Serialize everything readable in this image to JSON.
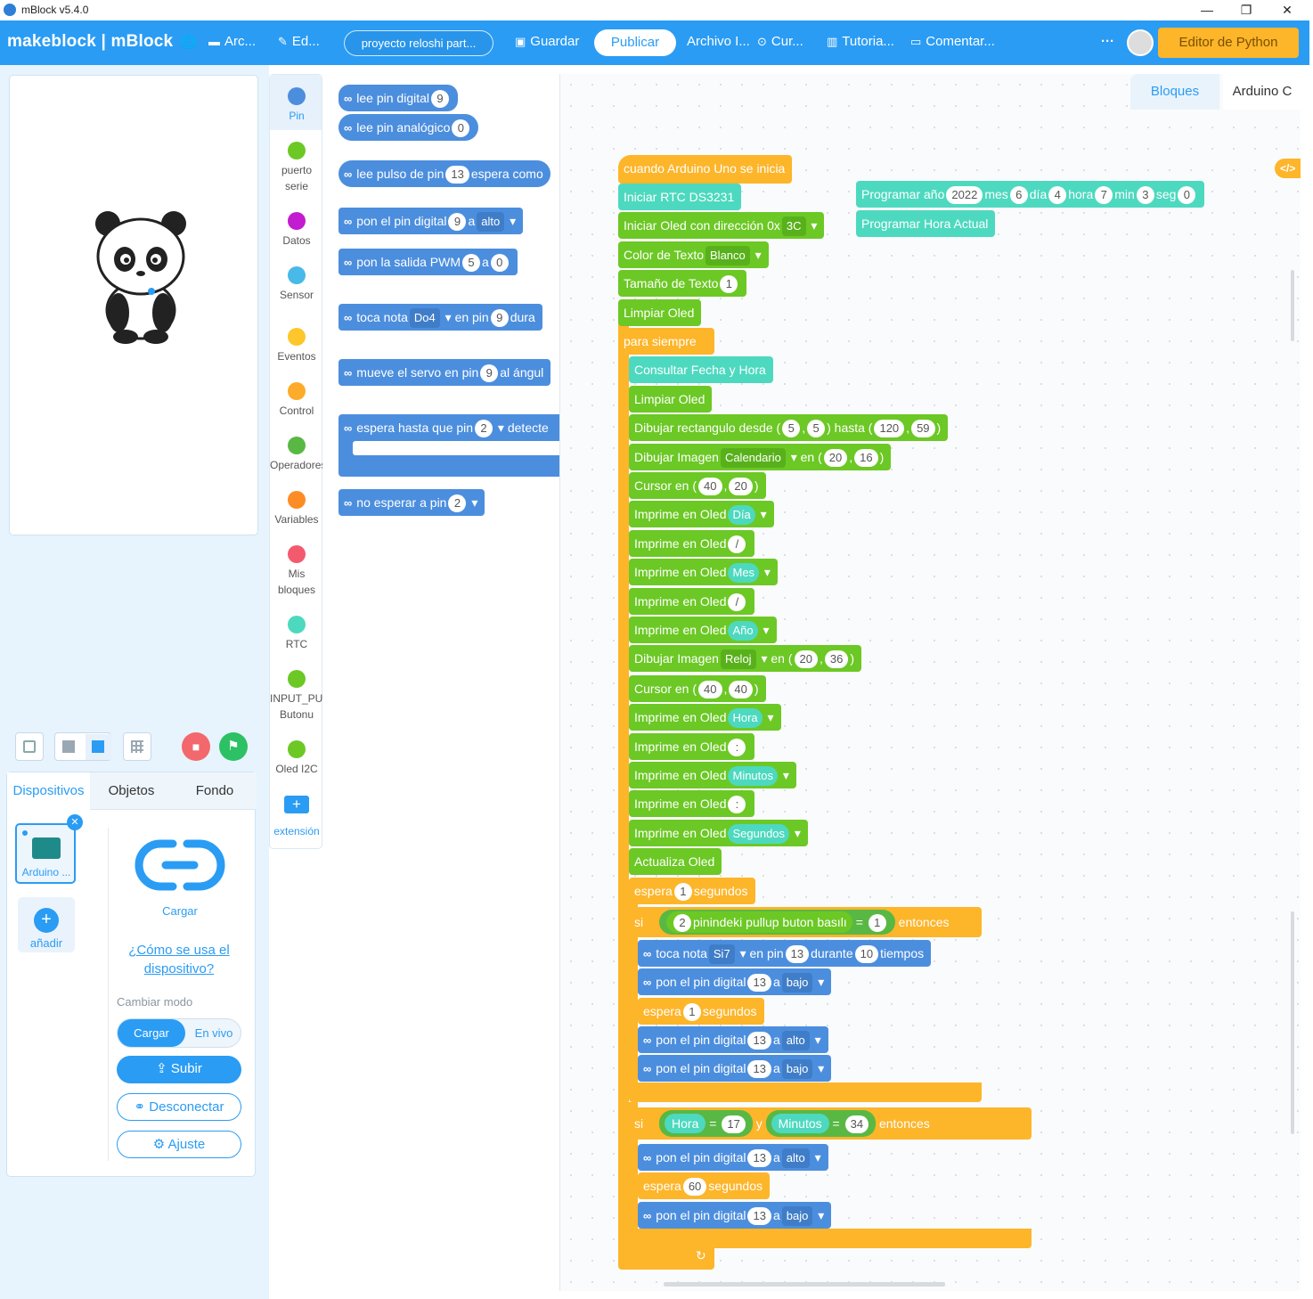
{
  "window": {
    "title": "mBlock v5.4.0",
    "min": "—",
    "restore": "❐",
    "close": "✕"
  },
  "topbar": {
    "brand": "makeblock | mBlock",
    "globe": "🌐",
    "file": "Arc...",
    "edit": "Ed...",
    "project": "proyecto reloshi part...",
    "save": "Guardar",
    "publish": "Publicar",
    "archive": "Archivo I...",
    "course": "Cur...",
    "tutorials": "Tutoria...",
    "comment": "Comentar...",
    "more": "···",
    "python": "Editor de Python"
  },
  "stage_controls": {
    "stop": "■",
    "go": "⚑"
  },
  "device_panel": {
    "tabs": [
      "Dispositivos",
      "Objetos",
      "Fondo"
    ],
    "device_name": "Arduino ...",
    "add": "añadir",
    "connect_label": "Cargar",
    "help_link": "¿Cómo se usa el dispositivo?",
    "mode_label": "Cambiar modo",
    "mode_upload": "Cargar",
    "mode_live": "En vivo",
    "upload_btn": "Subir",
    "disconnect_btn": "Desconectar",
    "settings_btn": "Ajuste"
  },
  "categories": [
    {
      "label": "Pin",
      "color": "#4c8ede"
    },
    {
      "label": "puerto serie",
      "color": "#6cc825"
    },
    {
      "label": "Datos",
      "color": "#c21bd0"
    },
    {
      "label": "Sensor",
      "color": "#48b9e8"
    },
    {
      "label": "Eventos",
      "color": "#fdc62a"
    },
    {
      "label": "Control",
      "color": "#fdab2a"
    },
    {
      "label": "Operadores",
      "color": "#59b844"
    },
    {
      "label": "Variables",
      "color": "#fd8c25"
    },
    {
      "label": "Mis bloques",
      "color": "#f35a6e"
    },
    {
      "label": "RTC",
      "color": "#4dd9bf"
    },
    {
      "label": "INPUT_PULL Butonu",
      "color": "#6cc825"
    },
    {
      "label": "Oled I2C",
      "color": "#6cc825"
    }
  ],
  "extension_label": "extensión",
  "palette": {
    "read_digital": "lee pin digital",
    "read_digital_v": "9",
    "read_analog": "lee pin analógico",
    "read_analog_v": "0",
    "pulse": "lee pulso de pin",
    "pulse_v": "13",
    "pulse_tail": "espera como",
    "set_digital": "pon el pin digital",
    "set_digital_v": "9",
    "a": "a",
    "alto": "alto",
    "pwm": "pon la salida PWM",
    "pwm_v": "5",
    "pwm_v2": "0",
    "note": "toca nota",
    "note_v": "Do4",
    "note_mid": "en pin",
    "note_pin": "9",
    "note_tail": "dura",
    "servo": "mueve el servo en pin",
    "servo_v": "9",
    "servo_tail": "al ángul",
    "wait_pin": "espera hasta que pin",
    "wait_pin_v": "2",
    "wait_pin_tail": "detecte",
    "nowait": "no esperar a pin",
    "nowait_v": "2"
  },
  "tabs_right": {
    "blocks": "Bloques",
    "arduino": "Arduino C",
    "code_icon": "</>"
  },
  "script": {
    "hat": "cuando Arduino Uno se inicia",
    "rtc_init": "Iniciar RTC DS3231",
    "oled_init": "Iniciar Oled con dirección 0x",
    "oled_addr": "3C",
    "text_color": "Color de Texto",
    "text_color_v": "Blanco",
    "text_size": "Tamaño de Texto",
    "text_size_v": "1",
    "clear": "Limpiar Oled",
    "forever": "para siempre",
    "query": "Consultar Fecha y Hora",
    "clear2": "Limpiar Oled",
    "rect": "Dibujar rectangulo desde (",
    "rect_v1": "5",
    "comma": ",",
    "rect_v2": "5",
    "rect_to": ") hasta (",
    "rect_v3": "120",
    "rect_v4": "59",
    "close_paren": ")",
    "img1": "Dibujar Imagen",
    "img1_v": "Calendario",
    "img1_en": "en (",
    "img1_x": "20",
    "img1_y": "16",
    "cursor1": "Cursor en (",
    "cursor1_x": "40",
    "cursor1_y": "20",
    "print": "Imprime en Oled",
    "p_dia": "Día",
    "p_slash": "/",
    "p_mes": "Mes",
    "p_anio": "Año",
    "img2_v": "Reloj",
    "img2_x": "20",
    "img2_y": "36",
    "cursor2_x": "40",
    "cursor2_y": "40",
    "p_hora": "Hora",
    "p_colon": ":",
    "p_min": "Minutos",
    "p_seg": "Segundos",
    "update": "Actualiza Oled",
    "wait": "espera",
    "wait_v": "1",
    "seconds": "segundos",
    "if": "si",
    "if1_pin": "2",
    "if1_text": "pinindeki pullup buton basılı",
    "eq": "=",
    "if1_v": "1",
    "then": "entonces",
    "note": "toca nota",
    "note_v": "Si7",
    "note_pin": "en pin",
    "note_pin_v": "13",
    "note_dur": "durante",
    "note_dur_v": "10",
    "note_tail": "tiempos",
    "set_pin": "pon el pin digital",
    "pin13": "13",
    "a": "a",
    "bajo": "bajo",
    "alto": "alto",
    "wait2_v": "1",
    "if2_hora": "Hora",
    "if2_hora_v": "17",
    "and": "y",
    "if2_min": "Minutos",
    "if2_min_v": "34",
    "wait3_v": "60",
    "set_date": "Programar año",
    "year": "2022",
    "mes": "mes",
    "mes_v": "6",
    "dia": "día",
    "dia_v": "4",
    "hora": "hora",
    "hora_v": "7",
    "min": "min",
    "min_v": "3",
    "seg": "seg",
    "seg_v": "0",
    "set_now": "Programar Hora Actual"
  }
}
